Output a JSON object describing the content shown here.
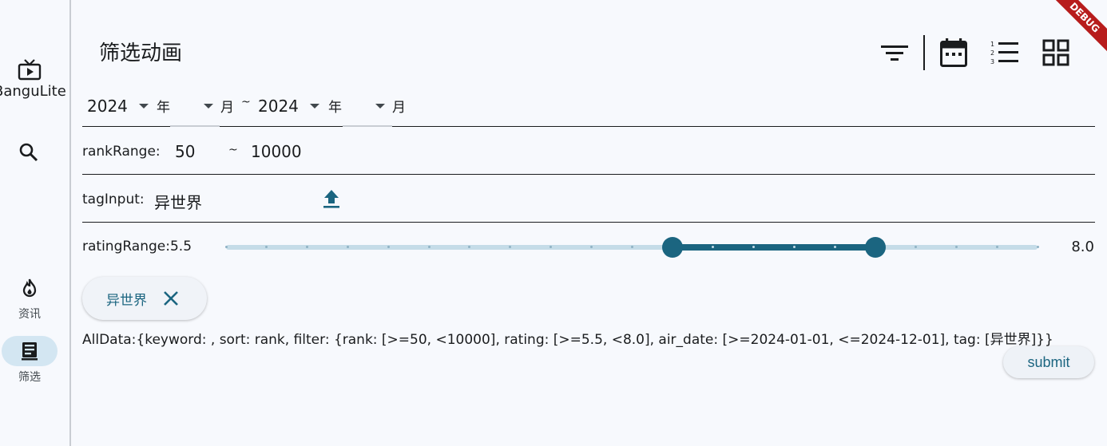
{
  "app": {
    "name": "BanguLite"
  },
  "nav": {
    "items": [
      {
        "label": "资讯",
        "icon": "fire-icon",
        "active": false
      },
      {
        "label": "筛选",
        "icon": "book-icon",
        "active": true
      }
    ]
  },
  "header": {
    "title": "筛选动画"
  },
  "date_range": {
    "start_year": "2024",
    "start_month": "",
    "end_year": "2024",
    "end_month": "",
    "year_unit": "年",
    "month_unit": "月",
    "separator": "~"
  },
  "rank_range": {
    "label": "rankRange:",
    "min": "50",
    "separator": "~",
    "max": "10000"
  },
  "tag_input": {
    "label": "tagInput:",
    "value": "异世界"
  },
  "rating_range": {
    "label": "ratingRange:5.5",
    "low": 5.5,
    "high": 8.0,
    "low_text": "5.5",
    "high_text": "8.0",
    "min": 0,
    "max": 10,
    "divisions": 20
  },
  "chips": [
    {
      "label": "异世界"
    }
  ],
  "summary": "AllData:{keyword: , sort: rank, filter: {rank: [>=50, <10000], rating: [>=5.5, <8.0], air_date: [>=2024-01-01, <=2024-12-01], tag: [异世界]}}",
  "submit_label": "submit",
  "debug_banner": "DEBUG",
  "colors": {
    "accent": "#1b6580",
    "accent_light": "#c5dce8",
    "background": "#f7f9fd",
    "debug": "#b71c1c"
  }
}
